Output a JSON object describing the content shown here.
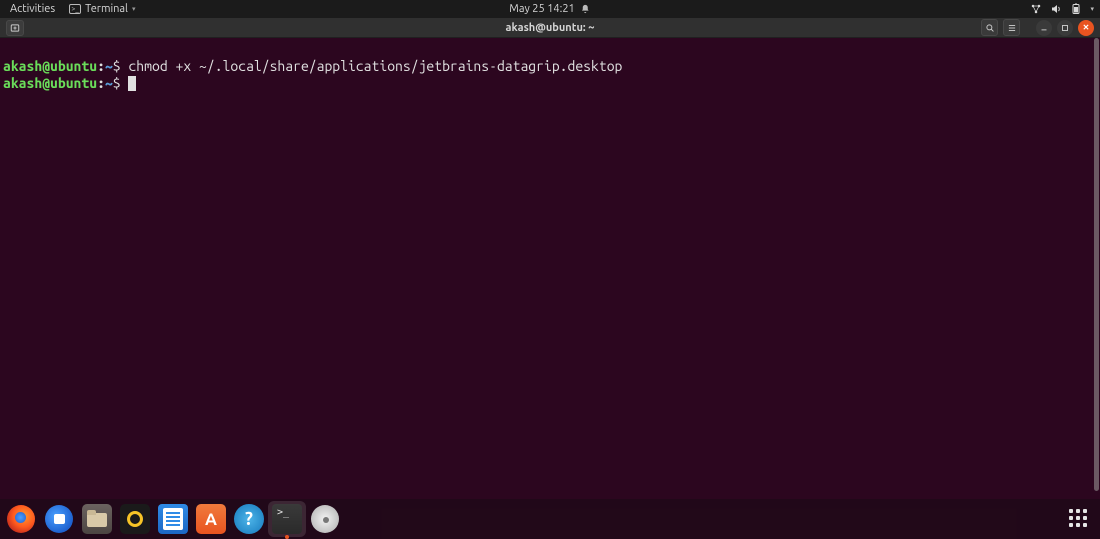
{
  "topbar": {
    "activities": "Activities",
    "app_label": "Terminal",
    "datetime": "May 25  14:21"
  },
  "window": {
    "title": "akash@ubuntu: ~"
  },
  "terminal": {
    "lines": [
      {
        "user": "akash@ubuntu",
        "colon": ":",
        "path": "~",
        "dollar": "$ ",
        "cmd": "chmod +x ~/.local/share/applications/jetbrains-datagrip.desktop"
      },
      {
        "user": "akash@ubuntu",
        "colon": ":",
        "path": "~",
        "dollar": "$ ",
        "cmd": ""
      }
    ]
  },
  "dock": {
    "items": [
      {
        "name": "firefox"
      },
      {
        "name": "thunderbird"
      },
      {
        "name": "files"
      },
      {
        "name": "rhythmbox"
      },
      {
        "name": "libreoffice-writer"
      },
      {
        "name": "ubuntu-software"
      },
      {
        "name": "help"
      },
      {
        "name": "terminal",
        "active": true
      },
      {
        "name": "disc"
      }
    ]
  }
}
